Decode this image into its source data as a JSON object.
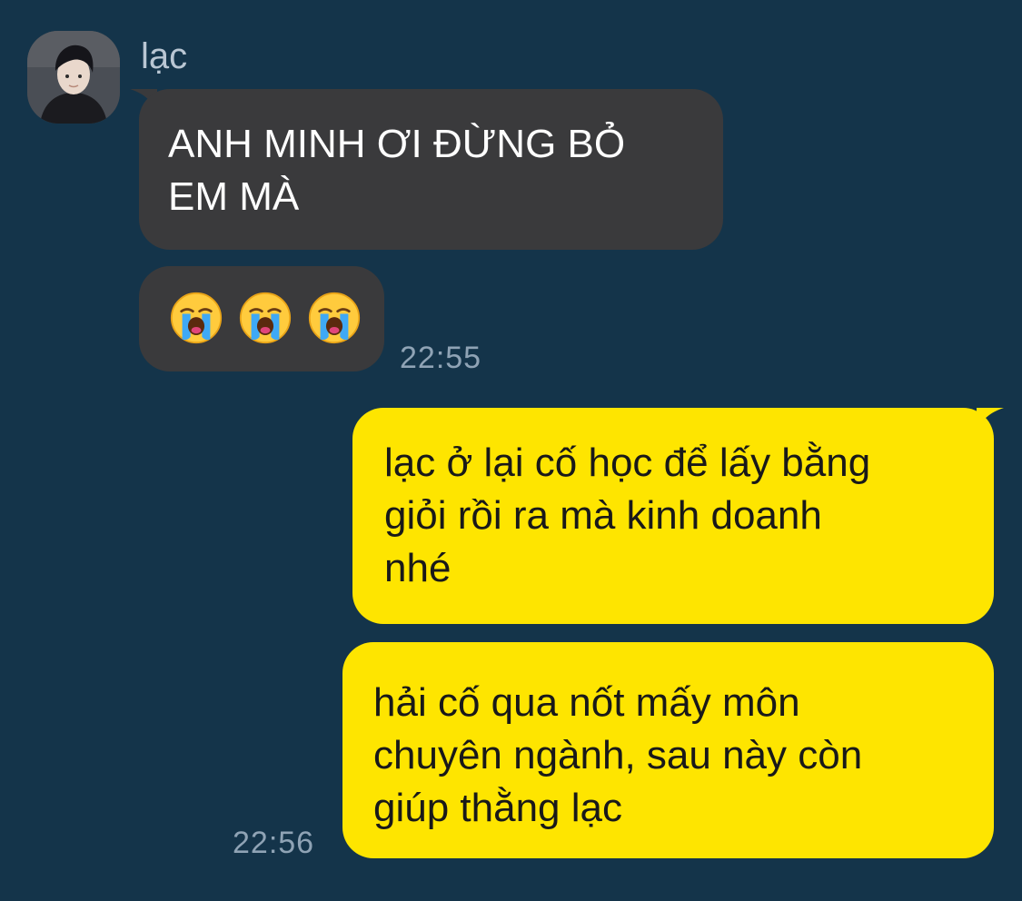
{
  "chat": {
    "sender_name": "lạc",
    "incoming": [
      {
        "text": "ANH MINH ƠI ĐỪNG BỎ\nEM MÀ"
      },
      {
        "emojis": [
          "loudly-crying-face",
          "loudly-crying-face",
          "loudly-crying-face"
        ]
      }
    ],
    "incoming_time": "22:55",
    "outgoing": [
      {
        "text": "lạc ở lại cố học để lấy bằng\ngiỏi rồi ra mà kinh doanh\nnhé"
      },
      {
        "text": "hải cố qua nốt mấy môn\nchuyên ngành, sau này còn\ngiúp thằng lạc"
      }
    ],
    "outgoing_time": "22:56"
  },
  "colors": {
    "background": "#14344a",
    "incoming_bubble": "#3a3a3c",
    "outgoing_bubble": "#fee500",
    "timestamp": "#8fa3b5"
  }
}
